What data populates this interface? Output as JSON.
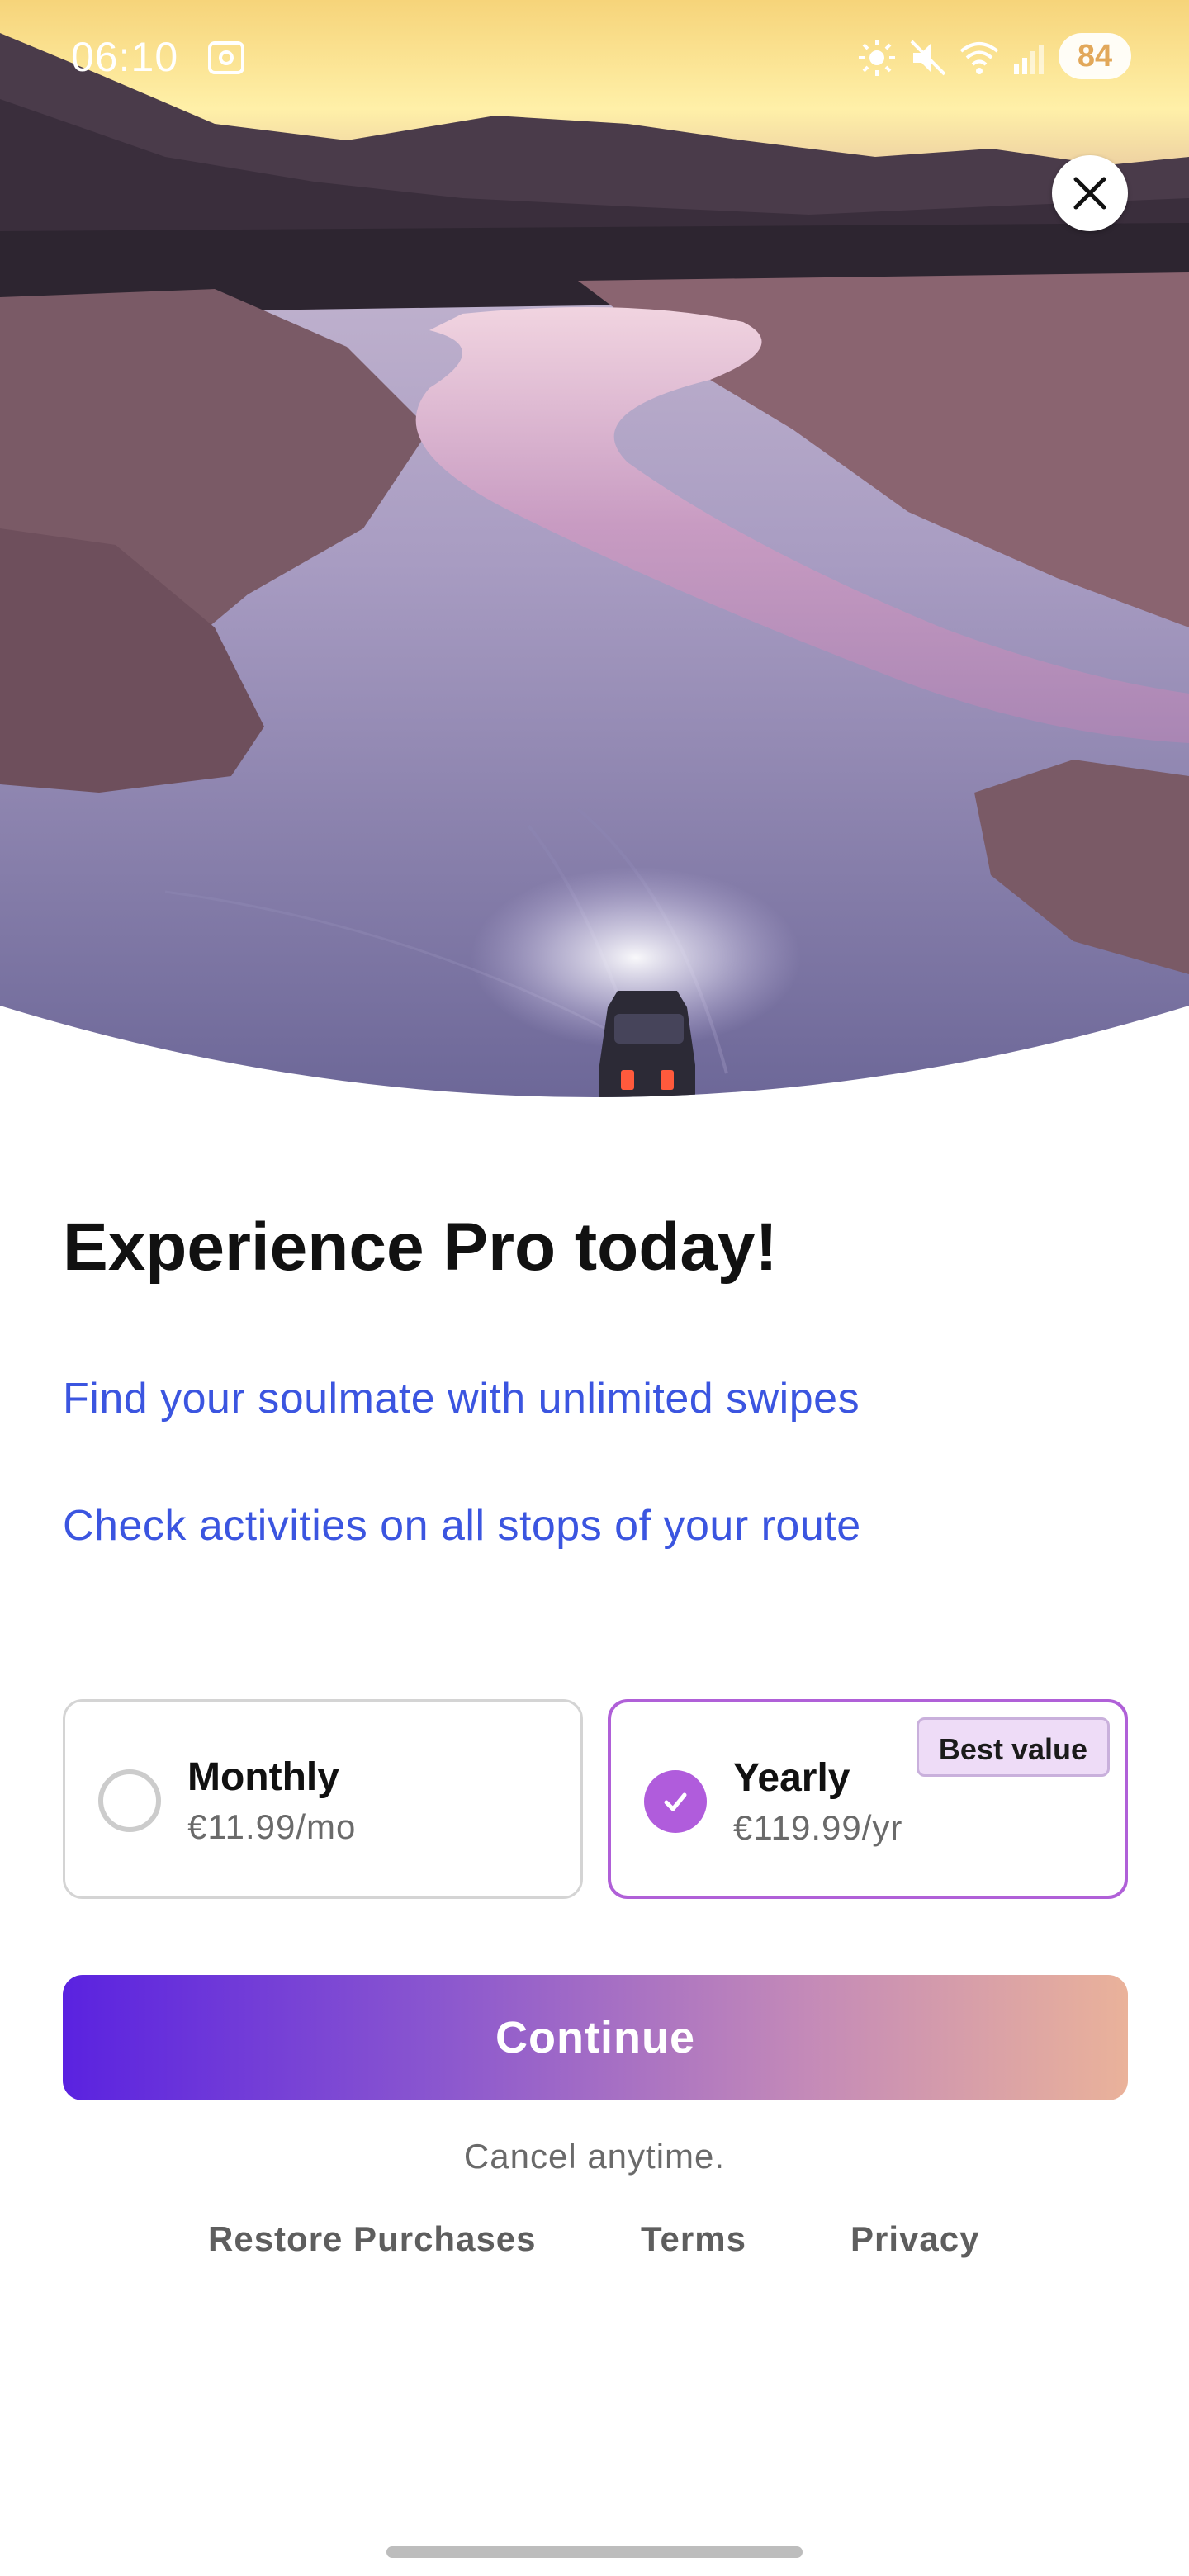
{
  "status_bar": {
    "time": "06:10",
    "battery": "84",
    "icons": [
      "screenshot-icon",
      "brightness-icon",
      "mute-icon",
      "wifi-icon",
      "signal-icon"
    ]
  },
  "hero": {
    "image": "snowy-river-valley-sunset-with-car-headlights",
    "close_icon": "close-icon"
  },
  "paywall": {
    "title": "Experience Pro today!",
    "features": [
      "Find your soulmate with unlimited swipes",
      "Check activities on all stops of your route"
    ]
  },
  "plans": [
    {
      "name": "Monthly",
      "price": "€11.99/mo",
      "selected": false
    },
    {
      "name": "Yearly",
      "price": "€119.99/yr",
      "selected": true,
      "badge": "Best value"
    }
  ],
  "actions": {
    "continue_label": "Continue",
    "cancel_note": "Cancel anytime."
  },
  "footer": {
    "restore": "Restore Purchases",
    "terms": "Terms",
    "privacy": "Privacy"
  },
  "colors": {
    "accent_link": "#3b55e0",
    "selected_plan": "#b05cdc",
    "button_gradient_start": "#5a22e0",
    "button_gradient_end": "#eab29a"
  }
}
